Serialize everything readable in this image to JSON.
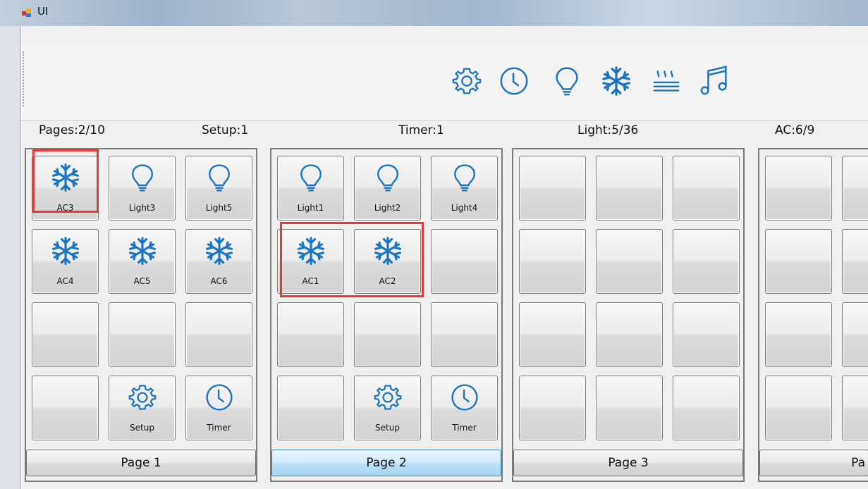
{
  "window": {
    "title": "UI"
  },
  "toolbar": {
    "icons": [
      "gear-icon",
      "clock-icon",
      "lightbulb-icon",
      "snowflake-icon",
      "heater-icon",
      "music-note-icon"
    ]
  },
  "status": {
    "pages": "Pages:2/10",
    "setup": "Setup:1",
    "timer": "Timer:1",
    "light": "Light:5/36",
    "ac": "AC:6/9"
  },
  "panels": [
    {
      "page_label": "Page 1",
      "tiles": [
        {
          "icon": "snowflake-icon",
          "label": "AC3"
        },
        {
          "icon": "lightbulb-icon",
          "label": "Light3"
        },
        {
          "icon": "lightbulb-icon",
          "label": "Light5"
        },
        {
          "icon": "snowflake-icon",
          "label": "AC4"
        },
        {
          "icon": "snowflake-icon",
          "label": "AC5"
        },
        {
          "icon": "snowflake-icon",
          "label": "AC6"
        },
        {
          "icon": "",
          "label": ""
        },
        {
          "icon": "",
          "label": ""
        },
        {
          "icon": "",
          "label": ""
        },
        {
          "icon": "",
          "label": ""
        },
        {
          "icon": "gear-icon",
          "label": "Setup"
        },
        {
          "icon": "clock-icon",
          "label": "Timer"
        }
      ]
    },
    {
      "page_label": "Page 2",
      "tiles": [
        {
          "icon": "lightbulb-icon",
          "label": "Light1"
        },
        {
          "icon": "lightbulb-icon",
          "label": "Light2"
        },
        {
          "icon": "lightbulb-icon",
          "label": "Light4"
        },
        {
          "icon": "snowflake-icon",
          "label": "AC1"
        },
        {
          "icon": "snowflake-icon",
          "label": "AC2"
        },
        {
          "icon": "",
          "label": ""
        },
        {
          "icon": "",
          "label": ""
        },
        {
          "icon": "",
          "label": ""
        },
        {
          "icon": "",
          "label": ""
        },
        {
          "icon": "",
          "label": ""
        },
        {
          "icon": "gear-icon",
          "label": "Setup"
        },
        {
          "icon": "clock-icon",
          "label": "Timer"
        }
      ]
    },
    {
      "page_label": "Page 3",
      "tiles": [
        {
          "icon": "",
          "label": ""
        },
        {
          "icon": "",
          "label": ""
        },
        {
          "icon": "",
          "label": ""
        },
        {
          "icon": "",
          "label": ""
        },
        {
          "icon": "",
          "label": ""
        },
        {
          "icon": "",
          "label": ""
        },
        {
          "icon": "",
          "label": ""
        },
        {
          "icon": "",
          "label": ""
        },
        {
          "icon": "",
          "label": ""
        },
        {
          "icon": "",
          "label": ""
        },
        {
          "icon": "",
          "label": ""
        },
        {
          "icon": "",
          "label": ""
        }
      ]
    },
    {
      "page_label": "Pa",
      "tiles": [
        {
          "icon": "",
          "label": ""
        },
        {
          "icon": "",
          "label": ""
        },
        {
          "icon": "",
          "label": ""
        },
        {
          "icon": "",
          "label": ""
        },
        {
          "icon": "",
          "label": ""
        },
        {
          "icon": "",
          "label": ""
        },
        {
          "icon": "",
          "label": ""
        },
        {
          "icon": "",
          "label": ""
        }
      ]
    }
  ],
  "active_page": "Page 2",
  "colors": {
    "icon_blue": "#1a74c4",
    "highlight": "#e23a3a",
    "active_button": "#b9e0f8"
  }
}
